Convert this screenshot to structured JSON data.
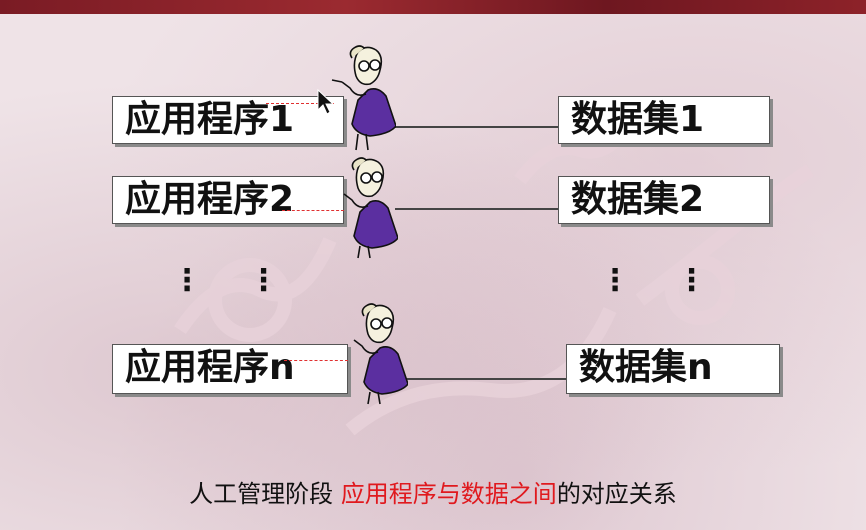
{
  "rows": [
    {
      "app": "应用程序1",
      "dataset": "数据集1"
    },
    {
      "app": "应用程序2",
      "dataset": "数据集2"
    },
    {
      "app": "应用程序n",
      "dataset": "数据集n"
    }
  ],
  "ellipsis": "⋮ ⋮",
  "caption": {
    "prefix": "人工管理阶段 ",
    "highlight": "应用程序与数据之间",
    "suffix": "的对应关系"
  },
  "colors": {
    "highlight": "#e0191e",
    "figure_robe": "#5b2fa0",
    "dashed": "#e03030"
  },
  "icons": [
    "programmer-figure-icon",
    "mouse-cursor-icon"
  ]
}
